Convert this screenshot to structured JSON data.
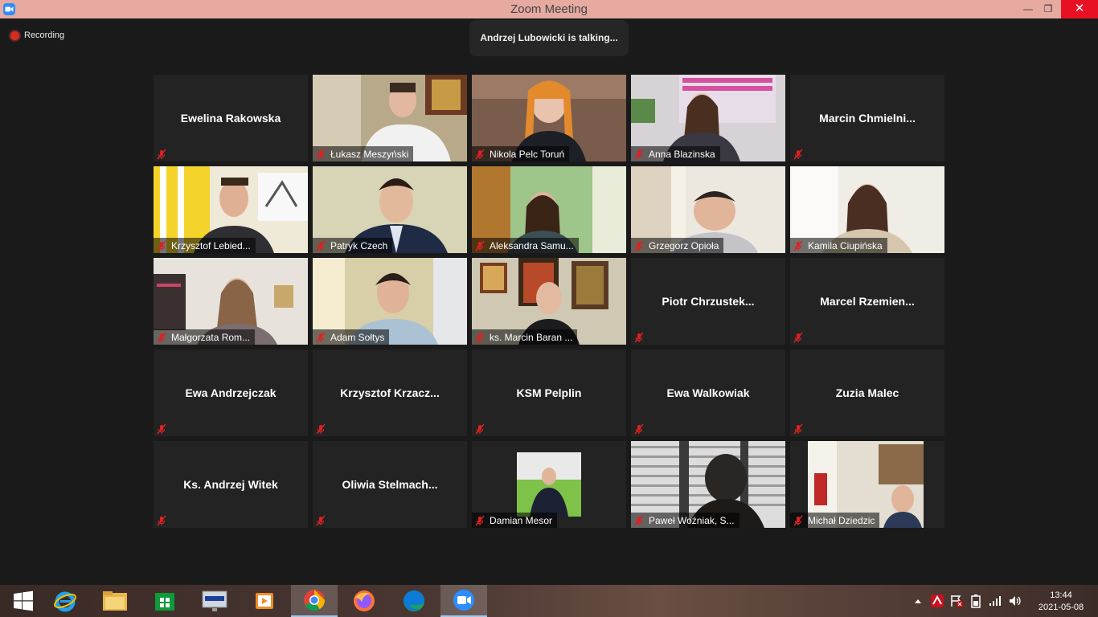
{
  "window": {
    "title": "Zoom Meeting",
    "minimize": "—",
    "restore": "❐",
    "close": "✕"
  },
  "recording_label": "Recording",
  "talking_banner": "Andrzej Lubowicki is talking...",
  "participants": [
    {
      "name": "Ewelina Rakowska",
      "video": false
    },
    {
      "name": "Łukasz Meszyński",
      "video": true,
      "scene": "man-desk"
    },
    {
      "name": "Nikola Pelc Toruń",
      "video": true,
      "scene": "woman-braids"
    },
    {
      "name": "Anna Blazinska",
      "video": true,
      "scene": "woman-window"
    },
    {
      "name": "Marcin  Chmielni...",
      "video": false
    },
    {
      "name": "Krzysztof Lebied...",
      "video": true,
      "scene": "man-glasses-curtain"
    },
    {
      "name": "Patryk Czech",
      "video": true,
      "scene": "man-suit"
    },
    {
      "name": "Aleksandra Samu...",
      "video": true,
      "scene": "woman-green"
    },
    {
      "name": "Grzegorz Opioła",
      "video": true,
      "scene": "man-door"
    },
    {
      "name": "Kamila Ciupińska",
      "video": true,
      "scene": "woman-light"
    },
    {
      "name": "Małgorzata Rom...",
      "video": true,
      "scene": "woman-shelf"
    },
    {
      "name": "Adam Sołtys",
      "video": true,
      "scene": "man-blinds"
    },
    {
      "name": "ks. Marcin Baran ...",
      "video": true,
      "scene": "priest-icons"
    },
    {
      "name": "Piotr  Chrzustek...",
      "video": false
    },
    {
      "name": "Marcel  Rzemien...",
      "video": false
    },
    {
      "name": "Ewa Andrzejczak",
      "video": false
    },
    {
      "name": "Krzysztof  Krzacz...",
      "video": false
    },
    {
      "name": "KSM Pelplin",
      "video": false
    },
    {
      "name": "Ewa Walkowiak",
      "video": false
    },
    {
      "name": "Zuzia Malec",
      "video": false
    },
    {
      "name": "Ks. Andrzej Witek",
      "video": false
    },
    {
      "name": "Oliwia  Stelmach...",
      "video": false
    },
    {
      "name": "Damian Mesor",
      "video": true,
      "scene": "photo-small"
    },
    {
      "name": "Paweł Woźniak, S...",
      "video": true,
      "scene": "silhouette-blinds"
    },
    {
      "name": "Michał Dziedzic",
      "video": true,
      "scene": "man-kitchen"
    }
  ],
  "taskbar": {
    "apps": [
      "start-icon",
      "internet-explorer-icon",
      "file-explorer-icon",
      "store-icon",
      "lenovo-icon",
      "media-player-icon",
      "chrome-icon",
      "firefox-icon",
      "edge-icon",
      "zoom-icon"
    ],
    "time": "13:44",
    "date": "2021-05-08"
  },
  "colors": {
    "titlebar": "#e6aaa0",
    "close": "#e81123",
    "background": "#1a1a1a",
    "tile": "#232323",
    "muted_mic": "#e02020"
  }
}
